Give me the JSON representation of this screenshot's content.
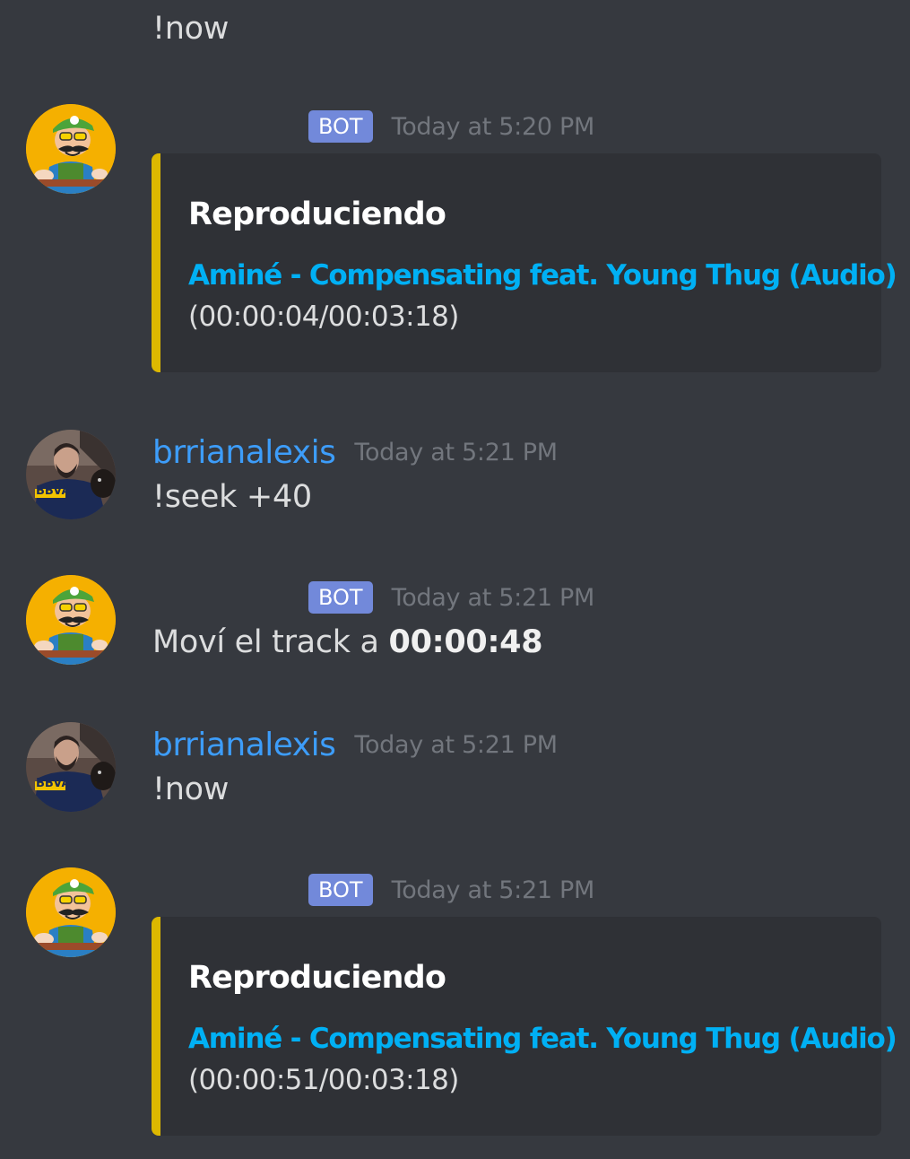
{
  "messages": [
    {
      "author": "",
      "is_bot": false,
      "timestamp": "",
      "text": "!now"
    },
    {
      "author": "",
      "is_bot": true,
      "bot_tag": "BOT",
      "timestamp": "Today at 5:20 PM",
      "embed": {
        "accent_color": "#ddb800",
        "title": "Reproduciendo",
        "link_text": "Aminé - Compensating feat. Young Thug (Audio)",
        "progress": "(00:00:04/00:03:18)"
      }
    },
    {
      "author": "brrianalexis",
      "is_bot": false,
      "timestamp": "Today at 5:21 PM",
      "text": "!seek +40"
    },
    {
      "author": "",
      "is_bot": true,
      "bot_tag": "BOT",
      "timestamp": "Today at 5:21 PM",
      "text_prefix": "Moví el track a ",
      "text_bold": "00:00:48"
    },
    {
      "author": "brrianalexis",
      "is_bot": false,
      "timestamp": "Today at 5:21 PM",
      "text": "!now"
    },
    {
      "author": "",
      "is_bot": true,
      "bot_tag": "BOT",
      "timestamp": "Today at 5:21 PM",
      "embed": {
        "accent_color": "#ddb800",
        "title": "Reproduciendo",
        "link_text": "Aminé - Compensating feat. Young Thug (Audio)",
        "progress": "(00:00:51/00:03:18)"
      }
    }
  ],
  "avatars": {
    "bot": "luigi-cartoon-avatar",
    "user": "user-photo-avatar"
  },
  "user_avatar_badge": "BBVA",
  "colors": {
    "background": "#36393f",
    "username": "#3d9dfa",
    "bot_tag": "#7289da",
    "timestamp": "#72767d",
    "embed_bg": "#2f3136",
    "embed_link": "#00b0f4"
  }
}
